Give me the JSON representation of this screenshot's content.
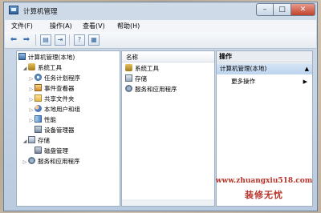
{
  "window": {
    "title": "计算机管理"
  },
  "menu": [
    "文件(F)",
    "操作(A)",
    "查看(V)",
    "帮助(H)"
  ],
  "tree": [
    {
      "label": "计算机管理(本地)",
      "icon": "computer-icon"
    },
    {
      "label": "系统工具",
      "icon": "tools-icon"
    },
    {
      "label": "任务计划程序",
      "icon": "scheduler-icon"
    },
    {
      "label": "事件查看器",
      "icon": "event-viewer-icon"
    },
    {
      "label": "共享文件夹",
      "icon": "shared-folder-icon"
    },
    {
      "label": "本地用户和组",
      "icon": "users-icon"
    },
    {
      "label": "性能",
      "icon": "performance-icon"
    },
    {
      "label": "设备管理器",
      "icon": "device-manager-icon"
    },
    {
      "label": "存储",
      "icon": "storage-icon"
    },
    {
      "label": "磁盘管理",
      "icon": "disk-icon"
    },
    {
      "label": "服务和应用程序",
      "icon": "services-icon"
    }
  ],
  "list": {
    "column": "名称",
    "items": [
      "系统工具",
      "存储",
      "服务和应用程序"
    ]
  },
  "actions": {
    "header": "操作",
    "selected": "计算机管理(本地)",
    "more": "更多操作"
  },
  "watermark": {
    "url": "www.zhuangxiu518.com",
    "brand": "装修无忧"
  }
}
